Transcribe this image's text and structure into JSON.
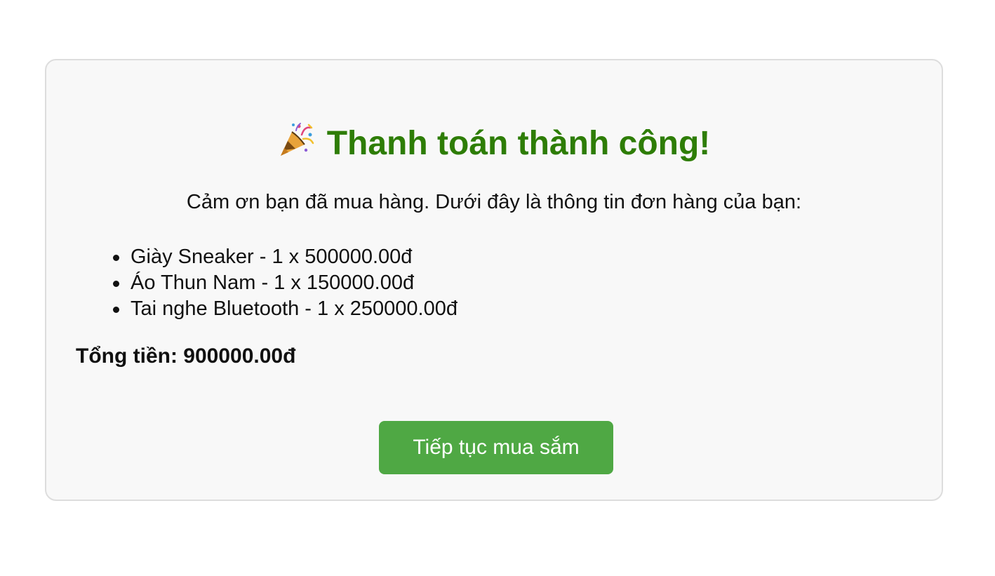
{
  "header": {
    "icon": "party-popper-icon",
    "title": "Thanh toán thành công!"
  },
  "intro_text": "Cảm ơn bạn đã mua hàng. Dưới đây là thông tin đơn hàng của bạn:",
  "order_items": [
    {
      "text": "Giày Sneaker - 1 x 500000.00đ"
    },
    {
      "text": "Áo Thun Nam - 1 x 150000.00đ"
    },
    {
      "text": "Tai nghe Bluetooth - 1 x 250000.00đ"
    }
  ],
  "total": "Tổng tiền: 900000.00đ",
  "continue_button": "Tiếp tục mua sắm",
  "colors": {
    "title": "#2e7d06",
    "button": "#4fa844",
    "card_background": "#f8f8f8",
    "card_border": "#dddddd"
  }
}
